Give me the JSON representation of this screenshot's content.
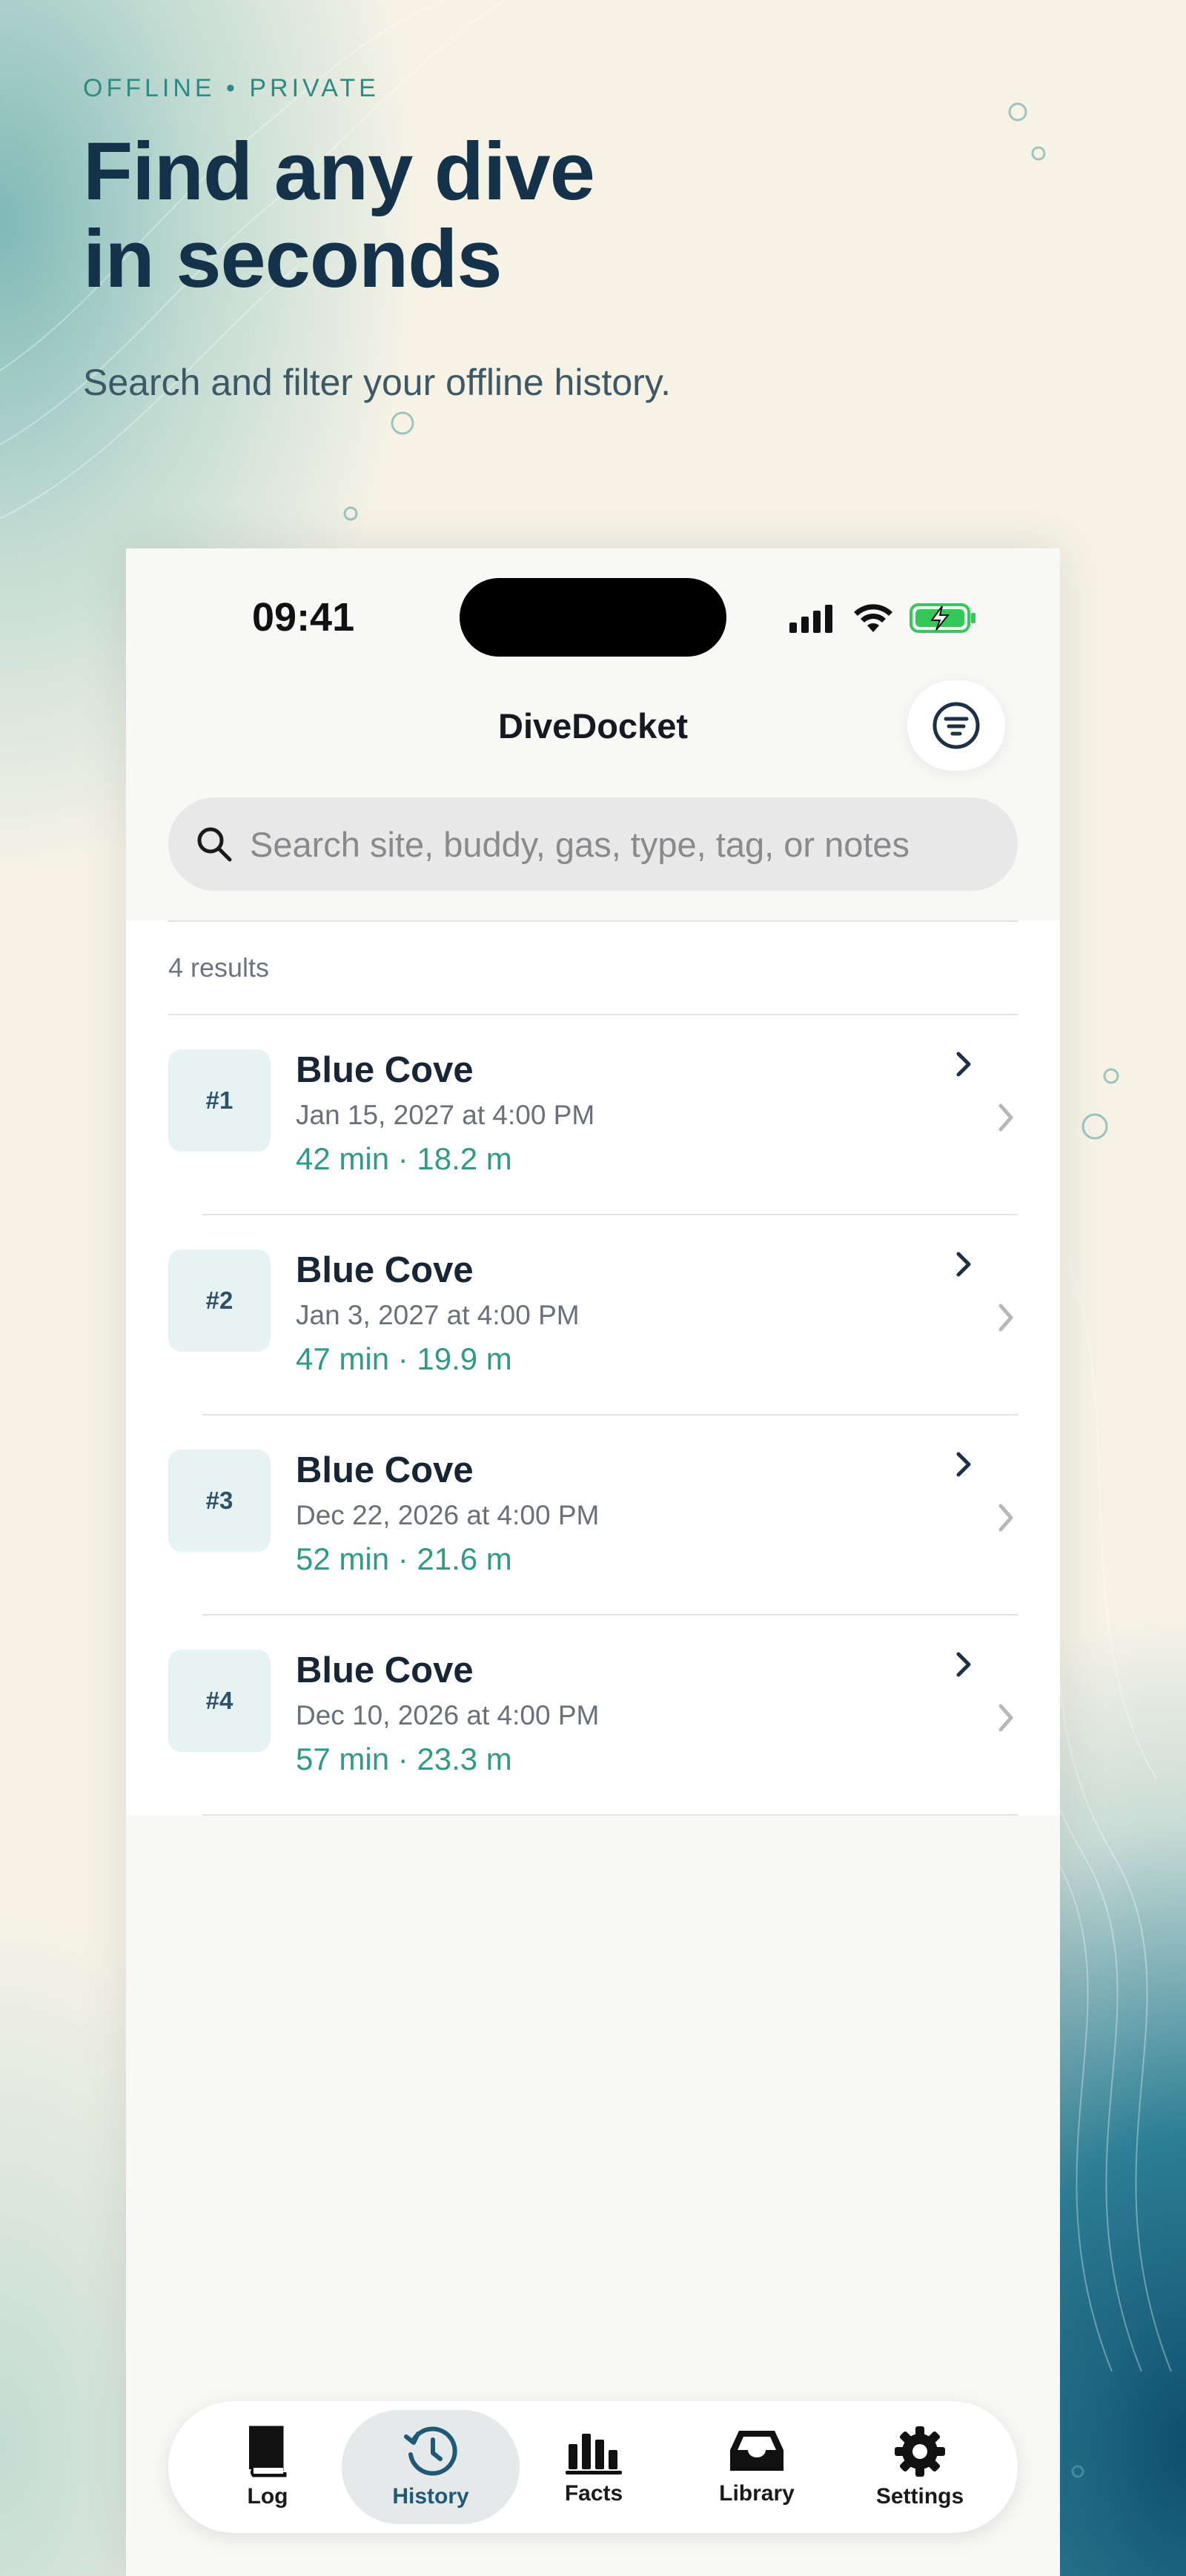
{
  "hero": {
    "eyebrow": "OFFLINE • PRIVATE",
    "headline": "Find any dive\nin seconds",
    "subhead": "Search and filter your offline history."
  },
  "status_bar": {
    "time": "09:41",
    "icons": [
      "cellular-signal-icon",
      "wifi-icon",
      "battery-charging-icon"
    ]
  },
  "nav": {
    "title": "DiveDocket",
    "filter_icon": "filter-icon"
  },
  "search": {
    "placeholder": "Search site, buddy, gas, type, tag, or notes",
    "value": ""
  },
  "results": {
    "count_label": "4 results",
    "items": [
      {
        "badge": "#1",
        "site": "Blue Cove",
        "date": "Jan 15, 2027 at 4:00 PM",
        "stats": "42 min · 18.2 m"
      },
      {
        "badge": "#2",
        "site": "Blue Cove",
        "date": "Jan 3, 2027 at 4:00 PM",
        "stats": "47 min · 19.9 m"
      },
      {
        "badge": "#3",
        "site": "Blue Cove",
        "date": "Dec 22, 2026 at 4:00 PM",
        "stats": "52 min · 21.6 m"
      },
      {
        "badge": "#4",
        "site": "Blue Cove",
        "date": "Dec 10, 2026 at 4:00 PM",
        "stats": "57 min · 23.3 m"
      }
    ]
  },
  "tabbar": {
    "active": "History",
    "tabs": [
      {
        "label": "Log",
        "icon": "book-icon"
      },
      {
        "label": "History",
        "icon": "history-clock-icon"
      },
      {
        "label": "Facts",
        "icon": "bar-chart-icon"
      },
      {
        "label": "Library",
        "icon": "inbox-tray-icon"
      },
      {
        "label": "Settings",
        "icon": "gear-icon"
      }
    ]
  },
  "colors": {
    "accent": "#2f9a86",
    "title": "#14324a",
    "active_tab": "#1d5a78"
  }
}
